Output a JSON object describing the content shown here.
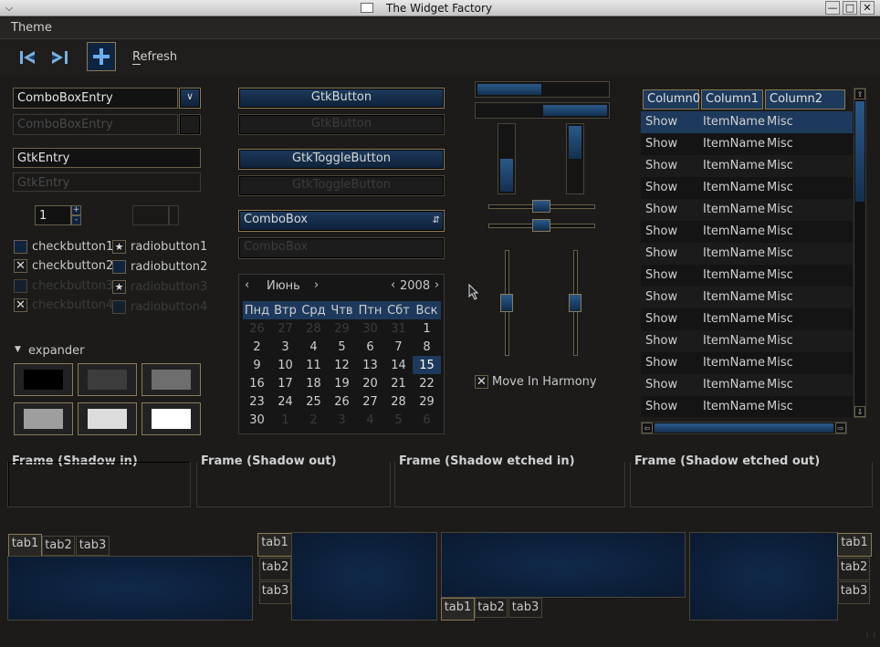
{
  "window": {
    "title": "The Widget Factory",
    "menu_icon": "chevron-down-icon"
  },
  "menu": {
    "theme": "Theme"
  },
  "toolbar": {
    "refresh": "Refresh"
  },
  "left": {
    "combo_entry": "ComboBoxEntry",
    "combo_entry_disabled": "ComboBoxEntry",
    "entry": "GtkEntry",
    "entry_disabled": "GtkEntry",
    "spin_value": "1",
    "checks": [
      "checkbutton1",
      "checkbutton2",
      "checkbutton3",
      "checkbutton4"
    ],
    "radios": [
      "radiobutton1",
      "radiobutton2",
      "radiobutton3",
      "radiobutton4"
    ],
    "expander": "expander",
    "swatches": [
      "#000000",
      "#3c3c3c",
      "#6e6e6e",
      "#9e9e9e",
      "#dcdcdc",
      "#ffffff"
    ]
  },
  "mid": {
    "button": "GtkButton",
    "button_disabled": "GtkButton",
    "toggle": "GtkToggleButton",
    "toggle_disabled": "GtkToggleButton",
    "combo": "ComboBox",
    "combo_disabled": "ComboBox",
    "calendar": {
      "month": "Июнь",
      "year": "2008",
      "days": [
        "Пнд",
        "Втр",
        "Срд",
        "Чтв",
        "Птн",
        "Сбт",
        "Вск"
      ],
      "weeks": [
        [
          "26",
          "27",
          "28",
          "29",
          "30",
          "31",
          "1"
        ],
        [
          "2",
          "3",
          "4",
          "5",
          "6",
          "7",
          "8"
        ],
        [
          "9",
          "10",
          "11",
          "12",
          "13",
          "14",
          "15"
        ],
        [
          "16",
          "17",
          "18",
          "19",
          "20",
          "21",
          "22"
        ],
        [
          "23",
          "24",
          "25",
          "26",
          "27",
          "28",
          "29"
        ],
        [
          "30",
          "1",
          "2",
          "3",
          "4",
          "5",
          "6"
        ]
      ],
      "selected": "15"
    }
  },
  "sliders": {
    "hbar1": 0.45,
    "hbar2": 0.5,
    "vbar1": 0.45,
    "vbar2": 0.55,
    "harmony": "Move In Harmony"
  },
  "tree": {
    "columns": [
      "Column0",
      "Column1",
      "Column2"
    ],
    "rows": [
      [
        "Show",
        "ItemName",
        "Misc"
      ],
      [
        "Show",
        "ItemName",
        "Misc"
      ],
      [
        "Show",
        "ItemName",
        "Misc"
      ],
      [
        "Show",
        "ItemName",
        "Misc"
      ],
      [
        "Show",
        "ItemName",
        "Misc"
      ],
      [
        "Show",
        "ItemName",
        "Misc"
      ],
      [
        "Show",
        "ItemName",
        "Misc"
      ],
      [
        "Show",
        "ItemName",
        "Misc"
      ],
      [
        "Show",
        "ItemName",
        "Misc"
      ],
      [
        "Show",
        "ItemName",
        "Misc"
      ],
      [
        "Show",
        "ItemName",
        "Misc"
      ],
      [
        "Show",
        "ItemName",
        "Misc"
      ],
      [
        "Show",
        "ItemName",
        "Misc"
      ],
      [
        "Show",
        "ItemName",
        "Misc"
      ]
    ]
  },
  "frames": [
    "Frame (Shadow in)",
    "Frame (Shadow out)",
    "Frame (Shadow etched in)",
    "Frame (Shadow etched out)"
  ],
  "tabs": [
    "tab1",
    "tab2",
    "tab3"
  ]
}
